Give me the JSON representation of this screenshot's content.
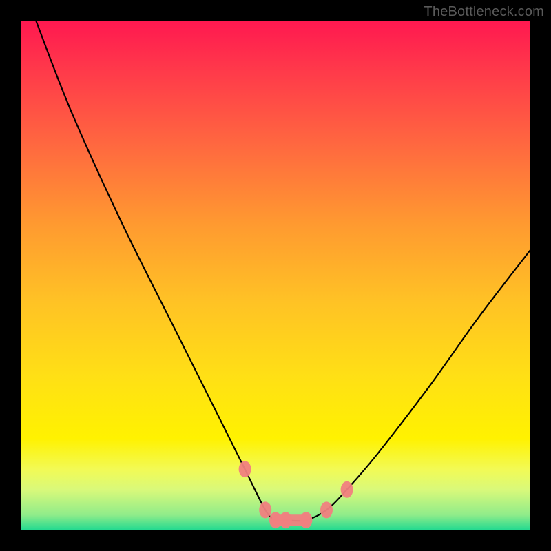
{
  "watermark": "TheBottleneck.com",
  "chart_data": {
    "type": "line",
    "title": "",
    "xlabel": "",
    "ylabel": "",
    "xlim": [
      0,
      100
    ],
    "ylim": [
      0,
      100
    ],
    "grid": false,
    "series": [
      {
        "name": "bottleneck-curve",
        "x": [
          3,
          10,
          20,
          30,
          38,
          44,
          48,
          50,
          52,
          56,
          60,
          64,
          70,
          80,
          90,
          100
        ],
        "y": [
          100,
          82,
          60,
          40,
          24,
          12,
          4,
          2,
          2,
          2,
          4,
          8,
          15,
          28,
          42,
          55
        ]
      }
    ],
    "annotations": {
      "markers_near_minimum": true,
      "marker_color": "#f08080"
    },
    "gradient_stops": [
      {
        "pos": 0.0,
        "color": "#ff1850"
      },
      {
        "pos": 0.1,
        "color": "#ff3a4a"
      },
      {
        "pos": 0.25,
        "color": "#ff6a3f"
      },
      {
        "pos": 0.4,
        "color": "#ff9a30"
      },
      {
        "pos": 0.55,
        "color": "#ffc225"
      },
      {
        "pos": 0.7,
        "color": "#ffe015"
      },
      {
        "pos": 0.82,
        "color": "#fff200"
      },
      {
        "pos": 0.88,
        "color": "#f2fa55"
      },
      {
        "pos": 0.92,
        "color": "#d9f97a"
      },
      {
        "pos": 0.97,
        "color": "#8fec8a"
      },
      {
        "pos": 1.0,
        "color": "#1fd990"
      }
    ]
  }
}
